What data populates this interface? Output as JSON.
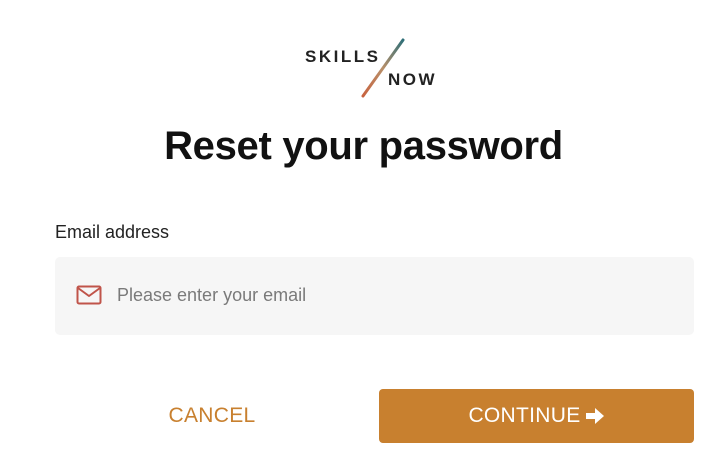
{
  "logo": {
    "word_top": "SKILLS",
    "word_bottom": "NOW",
    "icon": "logo-slash-icon"
  },
  "title": "Reset your password",
  "email": {
    "label": "Email address",
    "placeholder": "Please enter your email",
    "value": "",
    "icon": "mail-icon"
  },
  "actions": {
    "cancel_label": "CANCEL",
    "continue_label": "CONTINUE",
    "continue_icon": "arrow-right-icon"
  },
  "colors": {
    "accent": "#c8802f",
    "input_bg": "#f6f6f6",
    "mail_icon": "#c0544a"
  }
}
